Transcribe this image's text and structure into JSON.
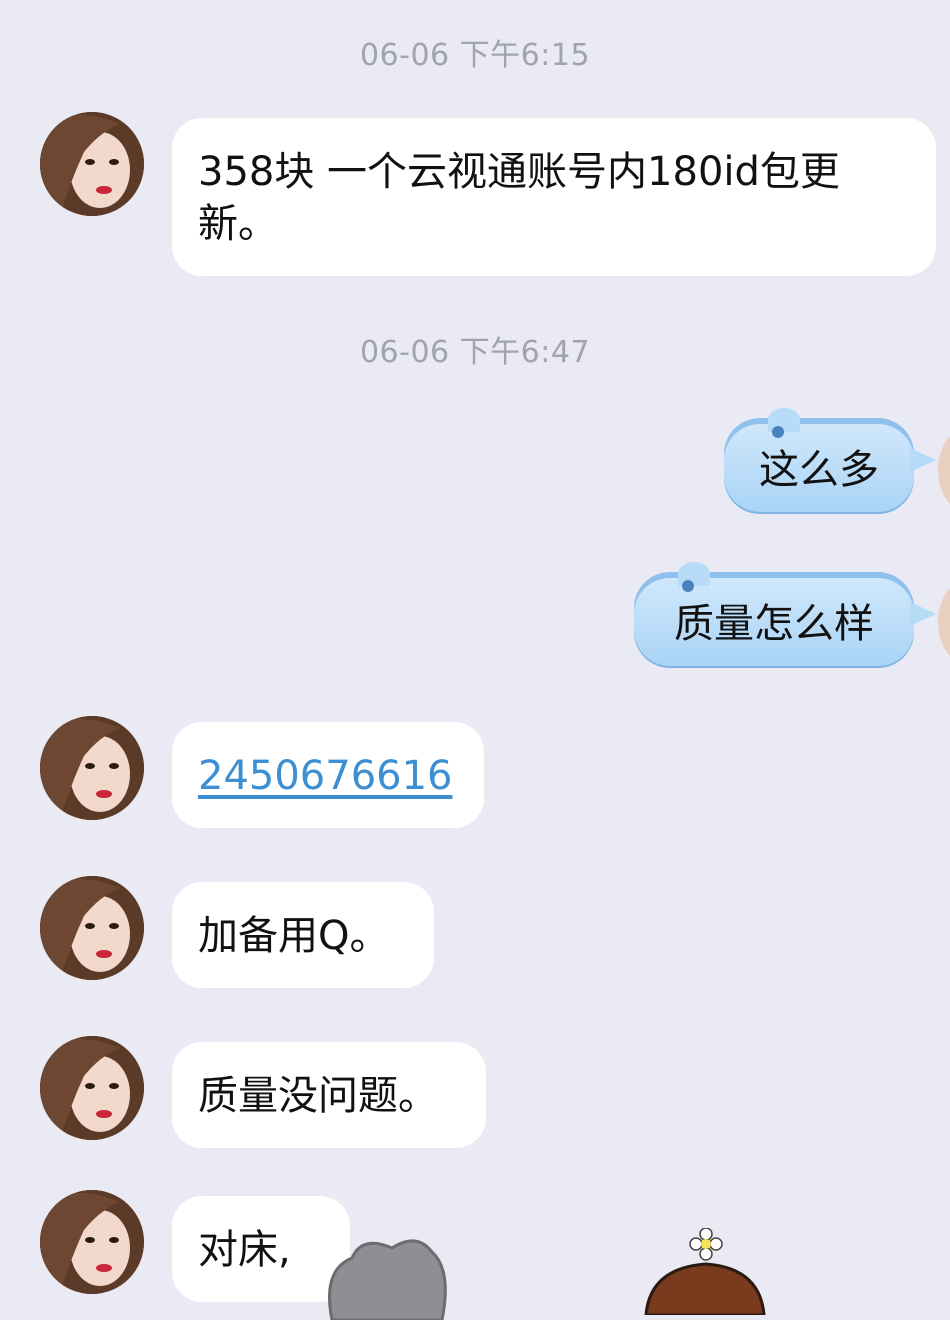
{
  "timestamps": [
    "06-06 下午6:15",
    "06-06 下午6:47"
  ],
  "messages": {
    "m1": "358块    一个云视通账号内180id包更新。",
    "m2": "这么多",
    "m3": "质量怎么样",
    "m4": "2450676616",
    "m5": "加备用Q。",
    "m6": "质量没问题。",
    "m7": "对床,"
  },
  "colors": {
    "background": "#e9eaf3",
    "incoming_bubble": "#ffffff",
    "outgoing_bubble": "#b6dbf6",
    "link": "#3d8fd1",
    "timestamp": "#a2a4ad"
  },
  "icons": {
    "avatar": "contact-avatar-photo",
    "sticker_left": "cartoon-gray-hair-sticker",
    "sticker_right": "cartoon-flower-girl-sticker"
  }
}
